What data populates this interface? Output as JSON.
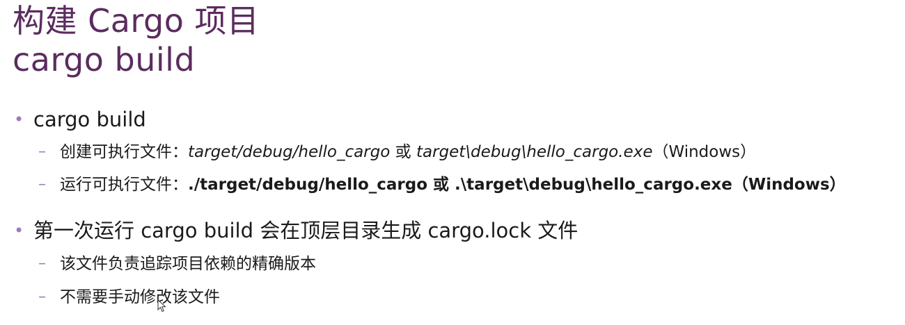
{
  "title": {
    "line1": "构建 Cargo 项目",
    "line2": "cargo build"
  },
  "bullets": {
    "b1": {
      "marker": "•",
      "text": "cargo build",
      "subs": [
        {
          "marker": "–",
          "label": "创建可执行文件：",
          "path1": "target/debug/hello_cargo",
          "conj": " 或 ",
          "path2": "target\\debug\\hello_cargo.exe",
          "suffix": "（Windows）"
        },
        {
          "marker": "–",
          "label": "运行可执行文件：",
          "path1": "./target/debug/hello_cargo",
          "conj": " 或 ",
          "path2": ".\\target\\debug\\hello_cargo.exe",
          "suffix": "（Windows）"
        }
      ]
    },
    "b2": {
      "marker": "•",
      "text": "第一次运行 cargo build 会在顶层目录生成 cargo.lock 文件",
      "subs": [
        {
          "marker": "–",
          "text": "该文件负责追踪项目依赖的精确版本"
        },
        {
          "marker": "–",
          "text": "不需要手动修改该文件"
        }
      ]
    }
  },
  "colors": {
    "title": "#5b2c5f",
    "bullet": "#9a7bbd",
    "text": "#1a1a1a"
  },
  "icons": {
    "cursor": "mouse-pointer-icon"
  }
}
